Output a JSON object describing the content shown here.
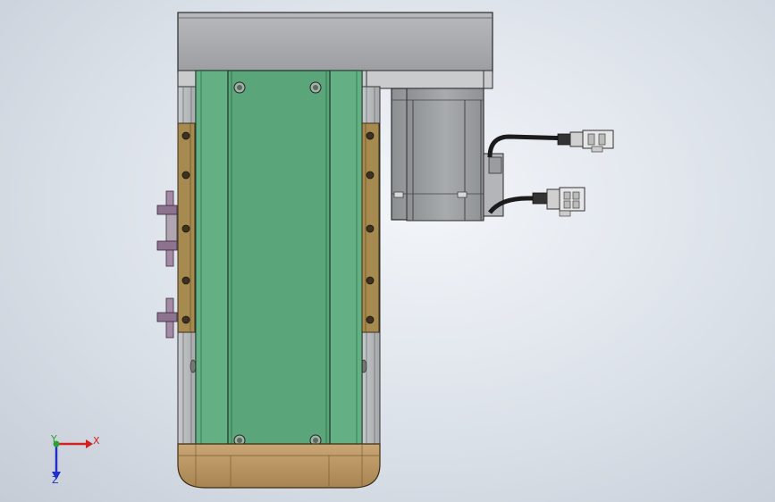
{
  "viewport": {
    "background_top": "#f3f6fa",
    "background_bottom": "#c5ccd6"
  },
  "colors": {
    "green_carriage": "#5aa57a",
    "green_edge": "#2f6e4b",
    "housing_gray": "#a9abae",
    "motor_gray": "#9ea1a4",
    "bracket_gold": "#a68a4f",
    "end_cap_gold": "#b89564",
    "bolt_purple": "#8e7390",
    "cable_black": "#1b1b1b"
  },
  "triad": {
    "x_label": "X",
    "y_label": "Y",
    "z_label": "Z",
    "x_color": "#d32020",
    "y_color": "#2fa033",
    "z_color": "#2030c8"
  }
}
